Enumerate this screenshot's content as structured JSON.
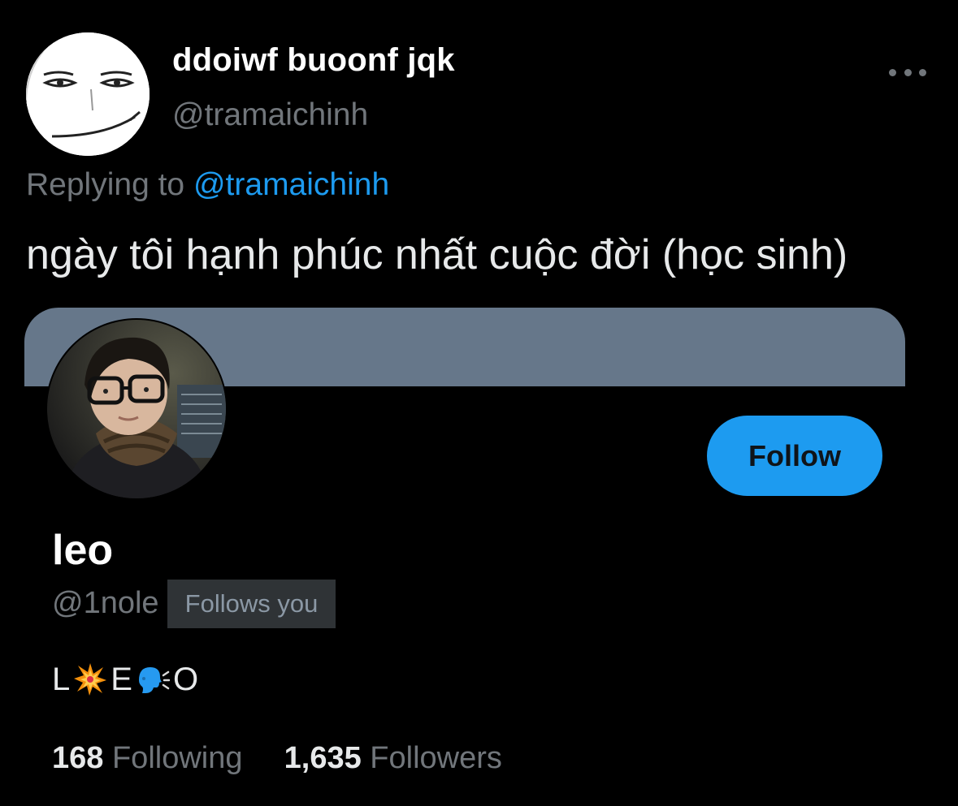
{
  "tweet": {
    "author": {
      "display_name": "ddoiwf buoonf jqk",
      "handle": "@tramaichinh",
      "avatar_icon": "man-face-avatar"
    },
    "more_icon": "ellipsis-icon",
    "replying_prefix": "Replying to",
    "replying_to": "@tramaichinh",
    "text": "ngày tôi hạnh phúc nhất cuộc đời (học sinh)"
  },
  "profile_card": {
    "banner_color": "#66778a",
    "avatar_icon": "user-photo-avatar",
    "follow_label": "Follow",
    "name": "leo",
    "handle": "@1nole",
    "follows_you": "Follows you",
    "bio": {
      "part1": "L",
      "emoji1": "collision-emoji",
      "part2": "E",
      "emoji2": "speaking-head-emoji",
      "part3": "O"
    },
    "stats": {
      "following_count": "168",
      "following_label": "Following",
      "followers_count": "1,635",
      "followers_label": "Followers"
    }
  },
  "colors": {
    "background": "#000000",
    "accent": "#1d9bf0",
    "muted_text": "#71767b"
  }
}
